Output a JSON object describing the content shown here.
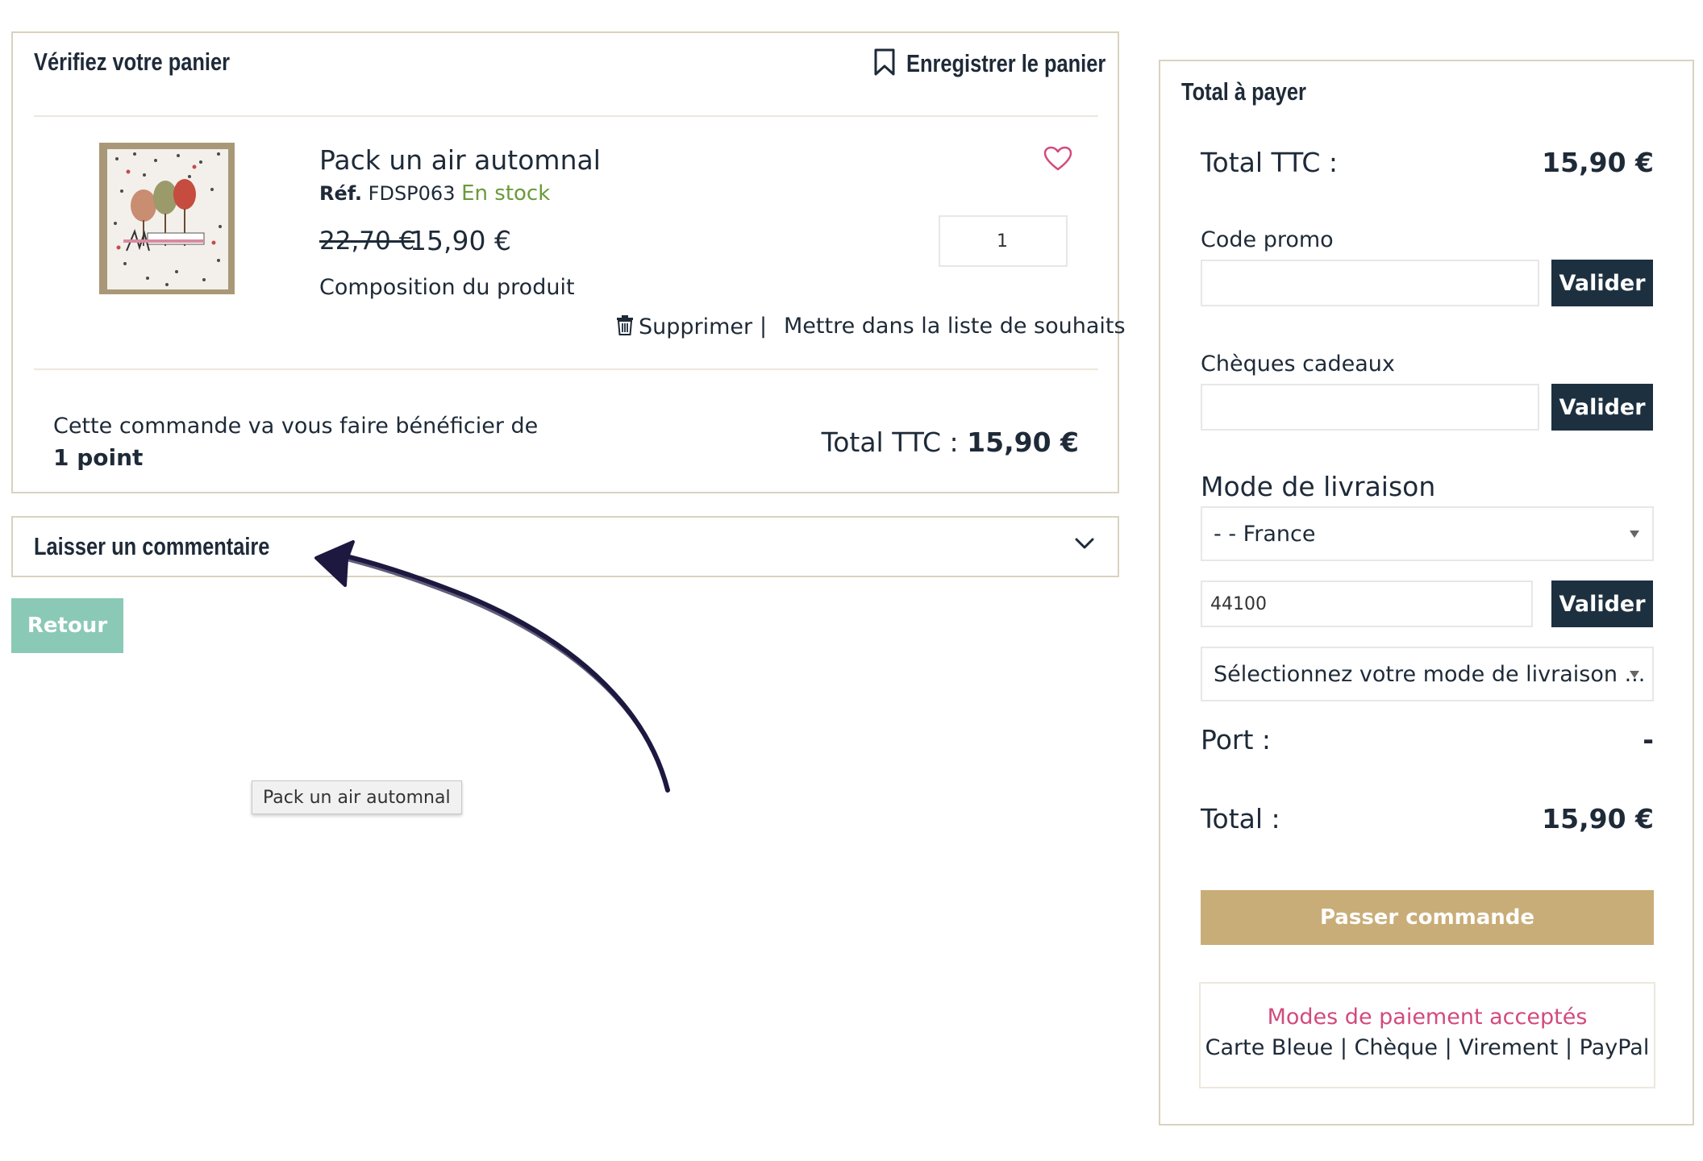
{
  "cart": {
    "title": "Vérifiez votre panier",
    "save_label": "Enregistrer le panier",
    "product": {
      "name": "Pack un air automnal",
      "ref_label": "Réf.",
      "ref_value": "FDSP063",
      "stock": "En stock",
      "old_price": "22,70 €",
      "price": "15,90 €",
      "quantity": "1",
      "composition_label": "Composition du produit",
      "delete_label": "Supprimer",
      "separator": "|",
      "wishlist_label": "Mettre dans la liste de souhaits"
    },
    "points_text": "Cette commande va vous faire bénéficier de",
    "points_value": "1 point",
    "total_label": "Total TTC :",
    "total_value": "15,90 €"
  },
  "comment": {
    "label": "Laisser un commentaire"
  },
  "back_label": "Retour",
  "tooltip": "Pack un air automnal",
  "summary": {
    "title": "Total à payer",
    "total_ttc_label": "Total TTC :",
    "total_ttc_value": "15,90 €",
    "promo_label": "Code promo",
    "promo_placeholder": "",
    "promo_button": "Valider",
    "gift_label": "Chèques cadeaux",
    "gift_placeholder": "",
    "gift_button": "Valider",
    "delivery_label": "Mode de livraison",
    "country": "- - France",
    "postcode": "44100",
    "postcode_button": "Valider",
    "delivery_select": "Sélectionnez votre mode de livraison ...",
    "port_label": "Port :",
    "port_value": "-",
    "total_label": "Total :",
    "total_value": "15,90 €",
    "order_button": "Passer commande",
    "payment_title": "Modes de paiement acceptés",
    "payment_methods": "Carte Bleue | Chèque | Virement | PayPal"
  },
  "colors": {
    "dark": "#1d3040",
    "gold": "#c9ad78",
    "teal": "#8ac9b5",
    "pink": "#d24a7c",
    "green": "#6a9a3a",
    "border": "#d9d3bf"
  }
}
